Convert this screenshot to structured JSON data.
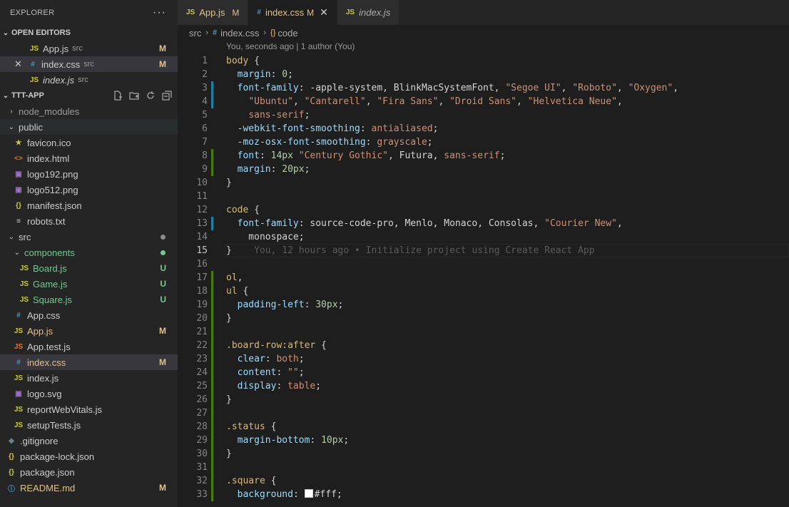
{
  "explorer": {
    "title": "EXPLORER",
    "more": "···",
    "open_editors_label": "OPEN EDITORS",
    "open_editors": [
      {
        "icon": "JS",
        "name": "App.js",
        "desc": "src",
        "badge": "M"
      },
      {
        "icon": "#",
        "name": "index.css",
        "desc": "src",
        "badge": "M"
      },
      {
        "icon": "JS",
        "name": "index.js",
        "desc": "src",
        "badge": ""
      }
    ],
    "project_label": "TTT-APP",
    "tree": [
      {
        "name": "node_modules",
        "badge": ""
      },
      {
        "name": "public",
        "badge": ""
      },
      {
        "name": "favicon.ico",
        "badge": ""
      },
      {
        "name": "index.html",
        "badge": ""
      },
      {
        "name": "logo192.png",
        "badge": ""
      },
      {
        "name": "logo512.png",
        "badge": ""
      },
      {
        "name": "manifest.json",
        "badge": ""
      },
      {
        "name": "robots.txt",
        "badge": ""
      },
      {
        "name": "src",
        "badge": ""
      },
      {
        "name": "components",
        "badge": ""
      },
      {
        "name": "Board.js",
        "badge": "U"
      },
      {
        "name": "Game.js",
        "badge": "U"
      },
      {
        "name": "Square.js",
        "badge": "U"
      },
      {
        "name": "App.css",
        "badge": ""
      },
      {
        "name": "App.js",
        "badge": "M"
      },
      {
        "name": "App.test.js",
        "badge": ""
      },
      {
        "name": "index.css",
        "badge": "M"
      },
      {
        "name": "index.js",
        "badge": ""
      },
      {
        "name": "logo.svg",
        "badge": ""
      },
      {
        "name": "reportWebVitals.js",
        "badge": ""
      },
      {
        "name": "setupTests.js",
        "badge": ""
      },
      {
        "name": ".gitignore",
        "badge": ""
      },
      {
        "name": "package-lock.json",
        "badge": ""
      },
      {
        "name": "package.json",
        "badge": ""
      },
      {
        "name": "README.md",
        "badge": "M"
      }
    ]
  },
  "tabs": [
    {
      "icon": "JS",
      "label": "App.js",
      "badge": "M"
    },
    {
      "icon": "#",
      "label": "index.css",
      "badge": "M",
      "close": "✕"
    },
    {
      "icon": "JS",
      "label": "index.js"
    }
  ],
  "breadcrumb": {
    "folder": "src",
    "file": "index.css",
    "symbol": "code",
    "sep": "›",
    "file_icon": "#",
    "symbol_icon": "{}"
  },
  "blame": {
    "top": "You, seconds ago | 1 author (You)",
    "inline": "You, 12 hours ago • Initialize project using Create React App"
  },
  "code_lines": [
    "body {",
    "  margin: 0;",
    "  font-family: -apple-system, BlinkMacSystemFont, \"Segoe UI\", \"Roboto\", \"Oxygen\",",
    "    \"Ubuntu\", \"Cantarell\", \"Fira Sans\", \"Droid Sans\", \"Helvetica Neue\",",
    "    sans-serif;",
    "  -webkit-font-smoothing: antialiased;",
    "  -moz-osx-font-smoothing: grayscale;",
    "  font: 14px \"Century Gothic\", Futura, sans-serif;",
    "  margin: 20px;",
    "}",
    "",
    "code {",
    "  font-family: source-code-pro, Menlo, Monaco, Consolas, \"Courier New\",",
    "    monospace;",
    "}",
    "",
    "ol,",
    "ul {",
    "  padding-left: 30px;",
    "}",
    "",
    ".board-row:after {",
    "  clear: both;",
    "  content: \"\";",
    "  display: table;",
    "}",
    "",
    ".status {",
    "  margin-bottom: 10px;",
    "}",
    "",
    ".square {",
    "  background: #fff;"
  ],
  "line_numbers": [
    "1",
    "2",
    "3",
    "4",
    "5",
    "6",
    "7",
    "8",
    "9",
    "10",
    "11",
    "12",
    "13",
    "14",
    "15",
    "16",
    "17",
    "18",
    "19",
    "20",
    "21",
    "22",
    "23",
    "24",
    "25",
    "26",
    "27",
    "28",
    "29",
    "30",
    "31",
    "32",
    "33"
  ]
}
